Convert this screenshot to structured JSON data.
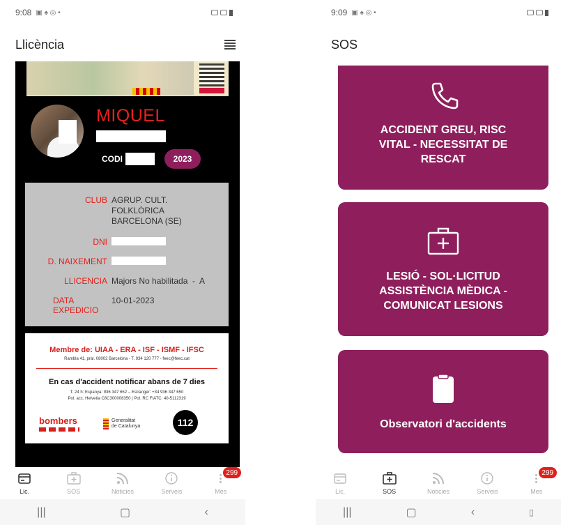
{
  "left_screen": {
    "status_bar": {
      "time": "9:08"
    },
    "header": {
      "title": "Llicència"
    },
    "license": {
      "first_name": "MIQUEL",
      "codi_label": "CODI",
      "year": "2023",
      "club_label": "CLUB",
      "club_value_lines": [
        "AGRUP. CULT.",
        "FOLKLÒRICA",
        "BARCELONA (SE)"
      ],
      "dni_label": "DNI",
      "birth_label": "D. NAIXEMENT",
      "licence_label": "LLICENCIA",
      "licence_value": "Majors No habilitada  -  A",
      "date_label_lines": [
        "DATA",
        "EXPEDICIO"
      ],
      "date_value": "10-01-2023"
    },
    "info_card": {
      "membre": "Membre de: UIAA - ERA - ISF - ISMF - IFSC",
      "address": "Rambla 41, pral. 08002 Barcelona - T. 934 120 777 - feec@feec.cat",
      "accident_notice": "En cas d'accident notificar abans de 7 dies",
      "phone_lines": [
        "T. 24 h: Espanya: 936 347 652 – Estranger: +34 936 347 650",
        "Pol. acc. Helvetia C8C300008350 | Pol. RC FIATC: 40-5112319"
      ],
      "bombers": "bombers",
      "gencat_lines": [
        "Generalitat",
        "de Catalunya"
      ],
      "emergency_number": "112"
    }
  },
  "right_screen": {
    "status_bar": {
      "time": "9:09"
    },
    "header": {
      "title": "SOS"
    },
    "buttons": [
      {
        "label_lines": [
          "ACCIDENT GREU, RISC",
          "VITAL - NECESSITAT DE",
          "RESCAT"
        ],
        "icon": "phone-icon"
      },
      {
        "label_lines": [
          "LESIÓ - SOL·LICITUD",
          "ASSISTÈNCIA MÈDICA -",
          "COMUNICAT LESIONS"
        ],
        "icon": "first-aid-kit-icon"
      },
      {
        "label_lines": [
          "Observatori d'accidents"
        ],
        "icon": "clipboard-icon"
      }
    ]
  },
  "bottom_nav": {
    "items": [
      {
        "label": "Lic.",
        "icon": "card-icon"
      },
      {
        "label": "SOS",
        "icon": "first-aid-icon"
      },
      {
        "label": "Noticies",
        "icon": "rss-icon"
      },
      {
        "label": "Serveis",
        "icon": "info-icon"
      },
      {
        "label": "Mes",
        "icon": "more-icon"
      }
    ],
    "badge": "299"
  },
  "colors": {
    "accent": "#8e1f5c",
    "label_red": "#e2201b",
    "panel_grey": "#c2c2c2"
  }
}
